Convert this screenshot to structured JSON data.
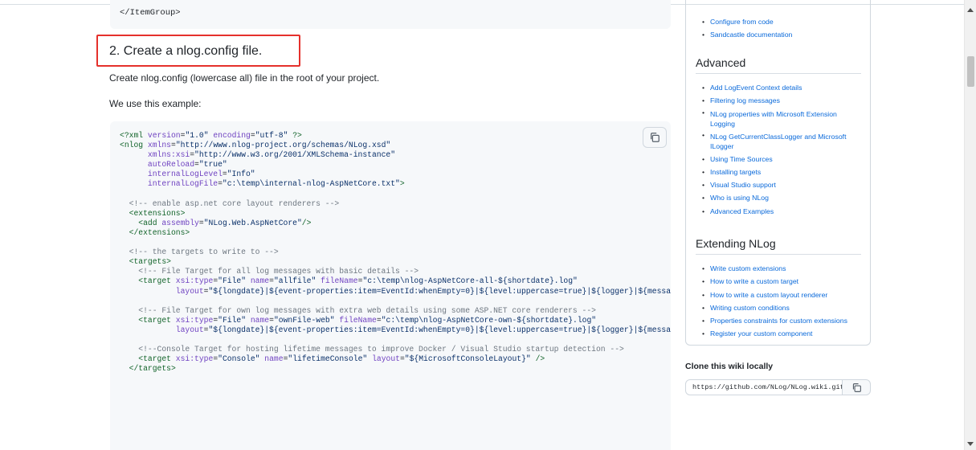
{
  "main": {
    "code_top_line": "</ItemGroup>",
    "heading": "2. Create a nlog.config file.",
    "para1": "Create nlog.config (lowercase all) file in the root of your project.",
    "para2": "We use this example:",
    "code_lines": [
      "<?xml version=\"1.0\" encoding=\"utf-8\" ?>",
      "<nlog xmlns=\"http://www.nlog-project.org/schemas/NLog.xsd\"",
      "      xmlns:xsi=\"http://www.w3.org/2001/XMLSchema-instance\"",
      "      autoReload=\"true\"",
      "      internalLogLevel=\"Info\"",
      "      internalLogFile=\"c:\\temp\\internal-nlog-AspNetCore.txt\">",
      "",
      "  <!-- enable asp.net core layout renderers -->",
      "  <extensions>",
      "    <add assembly=\"NLog.Web.AspNetCore\"/>",
      "  </extensions>",
      "",
      "  <!-- the targets to write to -->",
      "  <targets>",
      "    <!-- File Target for all log messages with basic details -->",
      "    <target xsi:type=\"File\" name=\"allfile\" fileName=\"c:\\temp\\nlog-AspNetCore-all-${shortdate}.log\"",
      "            layout=\"${longdate}|${event-properties:item=EventId:whenEmpty=0}|${level:uppercase=true}|${logger}|${messa",
      "",
      "    <!-- File Target for own log messages with extra web details using some ASP.NET core renderers -->",
      "    <target xsi:type=\"File\" name=\"ownFile-web\" fileName=\"c:\\temp\\nlog-AspNetCore-own-${shortdate}.log\"",
      "            layout=\"${longdate}|${event-properties:item=EventId:whenEmpty=0}|${level:uppercase=true}|${logger}|${messa",
      "",
      "    <!--Console Target for hosting lifetime messages to improve Docker / Visual Studio startup detection -->",
      "    <target xsi:type=\"Console\" name=\"lifetimeConsole\" layout=\"${MicrosoftConsoleLayout}\" />",
      "  </targets>"
    ]
  },
  "sidebar": {
    "top_links": [
      "Configure from code",
      "Sandcastle documentation"
    ],
    "advanced": {
      "title": "Advanced",
      "links": [
        "Add LogEvent Context details",
        "Filtering log messages",
        "NLog properties with Microsoft Extension Logging",
        "NLog GetCurrentClassLogger and Microsoft ILogger",
        "Using Time Sources",
        "Installing targets",
        "Visual Studio support",
        "Who is using NLog",
        "Advanced Examples"
      ]
    },
    "extending": {
      "title": "Extending NLog",
      "links": [
        "Write custom extensions",
        "How to write a custom target",
        "How to write a custom layout renderer",
        "Writing custom conditions",
        "Properties constraints for custom extensions",
        "Register your custom component"
      ]
    },
    "clone": {
      "title": "Clone this wiki locally",
      "url": "https://github.com/NLog/NLog.wiki.git"
    }
  },
  "colors": {
    "link": "#0969da",
    "highlight_border": "#e5312c",
    "code_bg": "#f6f8fa"
  }
}
